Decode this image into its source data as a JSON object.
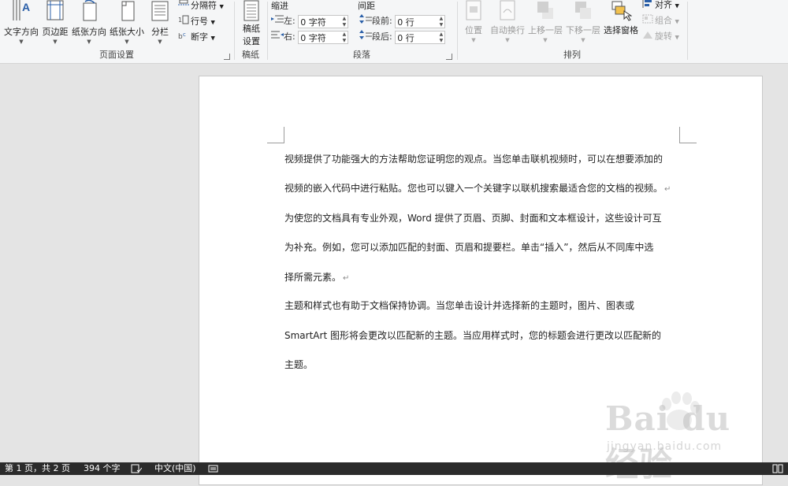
{
  "ribbon": {
    "page_setup": {
      "group_label": "页面设置",
      "text_direction": "文字方向",
      "margins": "页边距",
      "orientation": "纸张方向",
      "size": "纸张大小",
      "columns": "分栏",
      "breaks": "分隔符",
      "line_numbers": "行号",
      "hyphenation": "断字"
    },
    "manuscript": {
      "group_label": "稿纸",
      "button_line1": "稿纸",
      "button_line2": "设置"
    },
    "paragraph": {
      "group_label": "段落",
      "indent_header": "缩进",
      "spacing_header": "间距",
      "indent_left_label": "左:",
      "indent_left_value": "0 字符",
      "indent_right_label": "右:",
      "indent_right_value": "0 字符",
      "spacing_before_label": "段前:",
      "spacing_before_value": "0 行",
      "spacing_after_label": "段后:",
      "spacing_after_value": "0 行"
    },
    "arrange": {
      "group_label": "排列",
      "position": "位置",
      "wrap_text": "自动换行",
      "bring_forward": "上移一层",
      "send_backward": "下移一层",
      "selection_pane": "选择窗格",
      "align": "对齐",
      "group": "组合",
      "rotate": "旋转"
    }
  },
  "document": {
    "lines": [
      "视频提供了功能强大的方法帮助您证明您的观点。当您单击联机视频时，可以在想要添加的",
      "视频的嵌入代码中进行粘贴。您也可以键入一个关键字以联机搜索最适合您的文档的视频。",
      "为使您的文档具有专业外观，Word 提供了页眉、页脚、封面和文本框设计，这些设计可互",
      "为补充。例如，您可以添加匹配的封面、页眉和提要栏。单击“插入”，然后从不同库中选",
      "择所需元素。",
      "主题和样式也有助于文档保持协调。当您单击设计并选择新的主题时，图片、图表或",
      "SmartArt 图形将会更改以匹配新的主题。当应用样式时，您的标题会进行更改以匹配新的",
      "主题。"
    ],
    "paragraph_mark": "↵"
  },
  "watermark": {
    "text": "Bai du 经验",
    "url": "jingyan.baidu.com"
  },
  "status_bar": {
    "page_info": "第 1 页，共 2 页",
    "word_count": "394 个字",
    "language": "中文(中国)"
  }
}
